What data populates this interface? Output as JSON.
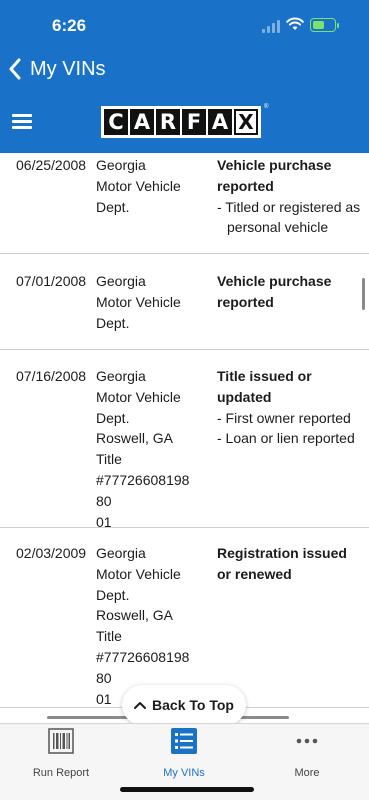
{
  "status_bar": {
    "time": "6:26",
    "battery_level": 0.6
  },
  "header": {
    "back_title": "My VINs",
    "logo_letters": [
      "C",
      "A",
      "R",
      "F",
      "A",
      "X"
    ],
    "logo_registered": "®"
  },
  "records": [
    {
      "date": "06/25/2008",
      "source": [
        "Georgia",
        "Motor Vehicle",
        "Dept."
      ],
      "event": [
        "Vehicle purchase",
        "reported"
      ],
      "details": [
        "- Titled or registered as personal vehicle"
      ]
    },
    {
      "date": "07/01/2008",
      "source": [
        "Georgia",
        "Motor Vehicle",
        "Dept."
      ],
      "event": [
        "Vehicle purchase",
        "reported"
      ],
      "details": []
    },
    {
      "date": "07/16/2008",
      "source": [
        "Georgia",
        "Motor Vehicle",
        "Dept.",
        "Roswell, GA",
        "Title",
        "#7772660819880",
        "01"
      ],
      "event": [
        "Title issued or",
        "updated"
      ],
      "details": [
        "- First owner reported",
        "- Loan or lien reported"
      ]
    },
    {
      "date": "02/03/2009",
      "source": [
        "Georgia",
        "Motor Vehicle",
        "Dept.",
        "Roswell, GA",
        "Title",
        "#7772660819880",
        "01"
      ],
      "event": [
        "Registration issued",
        "or renewed"
      ],
      "details": []
    }
  ],
  "back_to_top_label": "Back To Top",
  "tabs": [
    {
      "label": "Run Report",
      "icon": "barcode-icon"
    },
    {
      "label": "My VINs",
      "icon": "list-icon"
    },
    {
      "label": "More",
      "icon": "more-dots-icon"
    }
  ],
  "colors": {
    "brand_blue": "#1a72c8",
    "battery_green": "#7be36d"
  }
}
